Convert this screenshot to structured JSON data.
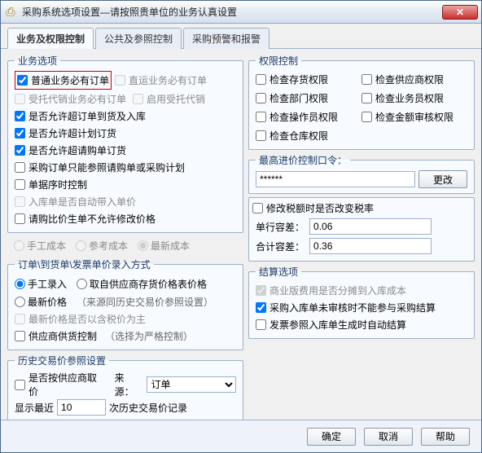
{
  "title": "采购系统选项设置—请按照贵单位的业务认真设置",
  "tabs": [
    "业务及权限控制",
    "公共及参照控制",
    "采购预警和报警"
  ],
  "biz": {
    "legend": "业务选项",
    "opt_normal": "普通业务必有订单",
    "opt_direct": "直运业务必有订单",
    "opt_daili": "受托代销业务必有订单",
    "opt_qiyong": "启用受托代销",
    "allow_over_in": "是否允许超订单到货及入库",
    "allow_over_plan": "是否允许超计划订货",
    "allow_over_req": "是否允许超请购单订货",
    "only_ref": "采购订单只能参照请购单或采购计划",
    "seq": "单据序时控制",
    "autoprice": "入库单是否自动带入单价",
    "noedit": "请购比价生单不允许修改价格"
  },
  "cost": {
    "manual": "手工成本",
    "ref": "参考成本",
    "latest": "最新成本"
  },
  "price_entry": {
    "legend": "订单\\到货单\\发票单价录入方式",
    "manual": "手工录入",
    "from_stock": "取自供应商存货价格表价格",
    "latest": "最新价格",
    "note": "（来源同历史交易价参照设置）",
    "tax_first": "最新价格是否以含税价为主",
    "supplier_ctrl": "供应商供货控制",
    "strict": "（选择为严格控制）"
  },
  "history": {
    "legend": "历史交易价参照设置",
    "by_supplier": "是否按供应商取价",
    "src_label": "来源：",
    "src_value": "订单",
    "recent_label_a": "显示最近",
    "recent_value": "10",
    "recent_label_b": "次历史交易价记录"
  },
  "perm": {
    "legend": "权限控制",
    "stock": "检查存货权限",
    "supplier": "检查供应商权限",
    "dept": "检查部门权限",
    "staff": "检查业务员权限",
    "oper": "检查操作员权限",
    "amount": "检查金额审核权限",
    "wh": "检查仓库权限"
  },
  "pwd": {
    "legend": "最高进价控制口令：",
    "value": "******",
    "btn": "更改"
  },
  "tax": {
    "chk": "修改税额时是否改变税率",
    "unit": "单行容差：",
    "unit_v": "0.06",
    "sum": "合计容差：",
    "sum_v": "0.36"
  },
  "settle": {
    "legend": "结算选项",
    "share": "商业版费用是否分摊到入库成本",
    "unaudited": "采购入库单未审核时不能参与采购结算",
    "auto": "发票参照入库单生成时自动结算"
  },
  "footer": {
    "ok": "确定",
    "cancel": "取消",
    "help": "帮助"
  }
}
